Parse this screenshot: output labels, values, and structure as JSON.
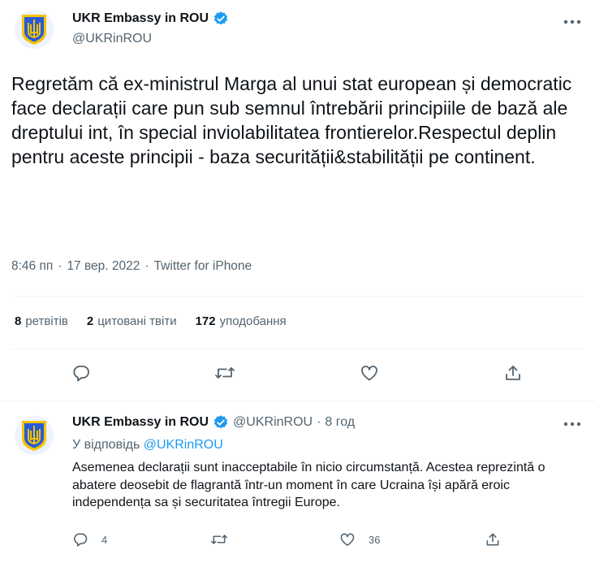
{
  "main_tweet": {
    "display_name": "UKR Embassy in ROU",
    "handle": "@UKRinROU",
    "avatar_icon": "ukraine-trident-icon",
    "verified_icon": "verified-badge-icon",
    "text": "Regretăm că ex-ministrul Marga al unui stat european și democratic face declarații care pun sub semnul întrebării principiile de bază ale dreptului int, în special inviolabilitatea frontierelor.Respectul deplin pentru aceste principii - baza securității&stabilității pe continent.",
    "time": "8:46 пп",
    "date": "17 вер. 2022",
    "source": "Twitter for iPhone",
    "separator": "·",
    "stats": {
      "retweets_count": "8",
      "retweets_label": "ретвітів",
      "quotes_count": "2",
      "quotes_label": "цитовані твіти",
      "likes_count": "172",
      "likes_label": "уподобання"
    }
  },
  "reply_tweet": {
    "display_name": "UKR Embassy in ROU",
    "handle": "@UKRinROU",
    "separator": "·",
    "time_ago": "8 год",
    "replying_to_label": "У відповідь",
    "replying_to_handle": "@UKRinROU",
    "text": "Asemenea declarații sunt inacceptabile în nicio circumstanță. Acestea reprezintă o abatere deosebit de flagrantă într-un moment în care Ucraina își apără eroic independența sa și securitatea întregii Europe.",
    "reply_count": "4",
    "like_count": "36"
  },
  "colors": {
    "accent": "#1d9bf0",
    "text_primary": "#0f1419",
    "text_secondary": "#536471",
    "divider": "#eff3f4",
    "trident_blue": "#2a5bd7",
    "trident_yellow": "#f5c400"
  }
}
